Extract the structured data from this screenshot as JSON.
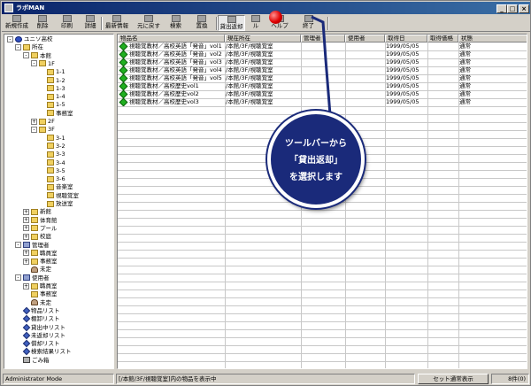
{
  "window": {
    "title": "ラボMAN",
    "controls": [
      "_",
      "□",
      "×"
    ]
  },
  "toolbar": [
    {
      "label": "新規作成",
      "icon": "new-doc-icon"
    },
    {
      "label": "削除",
      "icon": "delete-icon"
    },
    {
      "label": "印刷",
      "icon": "printer-icon"
    },
    {
      "label": "詳細",
      "icon": "detail-icon"
    },
    {
      "label": "最新情報",
      "icon": "refresh-icon"
    },
    {
      "label": "元に戻す",
      "icon": "undo-icon"
    },
    {
      "label": "検索",
      "icon": "search-icon"
    },
    {
      "label": "置換",
      "icon": "replace-icon"
    },
    {
      "label": "貸出返却",
      "icon": "lend-return-icon"
    },
    {
      "label": "ル",
      "icon": "tool-icon"
    },
    {
      "label": "ヘルプ",
      "icon": "help-icon"
    },
    {
      "label": "終了",
      "icon": "exit-icon"
    }
  ],
  "tree": [
    {
      "label": "ユニソ高校",
      "level": 0,
      "icon": "globe",
      "exp": "-"
    },
    {
      "label": "所在",
      "level": 1,
      "icon": "folder",
      "exp": "-"
    },
    {
      "label": "本館",
      "level": 2,
      "icon": "folder",
      "exp": "-"
    },
    {
      "label": "1F",
      "level": 3,
      "icon": "folder",
      "exp": "-"
    },
    {
      "label": "1-1",
      "level": 4,
      "icon": "folder",
      "exp": ""
    },
    {
      "label": "1-2",
      "level": 4,
      "icon": "folder",
      "exp": ""
    },
    {
      "label": "1-3",
      "level": 4,
      "icon": "folder",
      "exp": ""
    },
    {
      "label": "1-4",
      "level": 4,
      "icon": "folder",
      "exp": ""
    },
    {
      "label": "1-5",
      "level": 4,
      "icon": "folder",
      "exp": ""
    },
    {
      "label": "事務室",
      "level": 4,
      "icon": "folder",
      "exp": ""
    },
    {
      "label": "2F",
      "level": 3,
      "icon": "folder",
      "exp": "+"
    },
    {
      "label": "3F",
      "level": 3,
      "icon": "folder",
      "exp": "-"
    },
    {
      "label": "3-1",
      "level": 4,
      "icon": "folder",
      "exp": ""
    },
    {
      "label": "3-2",
      "level": 4,
      "icon": "folder",
      "exp": ""
    },
    {
      "label": "3-3",
      "level": 4,
      "icon": "folder",
      "exp": ""
    },
    {
      "label": "3-4",
      "level": 4,
      "icon": "folder",
      "exp": ""
    },
    {
      "label": "3-5",
      "level": 4,
      "icon": "folder",
      "exp": ""
    },
    {
      "label": "3-6",
      "level": 4,
      "icon": "folder",
      "exp": ""
    },
    {
      "label": "音楽室",
      "level": 4,
      "icon": "folder",
      "exp": ""
    },
    {
      "label": "視聴覚室",
      "level": 4,
      "icon": "folder",
      "exp": ""
    },
    {
      "label": "放送室",
      "level": 4,
      "icon": "folder",
      "exp": ""
    },
    {
      "label": "新館",
      "level": 2,
      "icon": "folder",
      "exp": "+"
    },
    {
      "label": "体育館",
      "level": 2,
      "icon": "folder",
      "exp": "+"
    },
    {
      "label": "プール",
      "level": 2,
      "icon": "folder",
      "exp": "+"
    },
    {
      "label": "校庭",
      "level": 2,
      "icon": "folder",
      "exp": "+"
    },
    {
      "label": "管理者",
      "level": 1,
      "icon": "grp",
      "exp": "-"
    },
    {
      "label": "職員室",
      "level": 2,
      "icon": "folder",
      "exp": "+"
    },
    {
      "label": "事務室",
      "level": 2,
      "icon": "folder",
      "exp": "+"
    },
    {
      "label": "未定",
      "level": 2,
      "icon": "user",
      "exp": ""
    },
    {
      "label": "使用者",
      "level": 1,
      "icon": "grp",
      "exp": "-"
    },
    {
      "label": "職員室",
      "level": 2,
      "icon": "folder",
      "exp": "+"
    },
    {
      "label": "事務室",
      "level": 2,
      "icon": "folder",
      "exp": ""
    },
    {
      "label": "未定",
      "level": 2,
      "icon": "user",
      "exp": ""
    },
    {
      "label": "物品リスト",
      "level": 1,
      "icon": "list",
      "exp": ""
    },
    {
      "label": "棚卸リスト",
      "level": 1,
      "icon": "list",
      "exp": ""
    },
    {
      "label": "貸出中リスト",
      "level": 1,
      "icon": "list",
      "exp": ""
    },
    {
      "label": "未返却リスト",
      "level": 1,
      "icon": "list",
      "exp": ""
    },
    {
      "label": "償却リスト",
      "level": 1,
      "icon": "list",
      "exp": ""
    },
    {
      "label": "検索結果リスト",
      "level": 1,
      "icon": "list",
      "exp": ""
    },
    {
      "label": "ごみ箱",
      "level": 1,
      "icon": "trash",
      "exp": ""
    }
  ],
  "grid": {
    "columns": [
      "物品名",
      "現在所在",
      "管理者",
      "使用者",
      "取得日",
      "取得価格",
      "状態"
    ],
    "rows": [
      [
        "視聴覚教材／高校英語「発音」vol1",
        "/本館/3F/視聴覚室",
        "",
        "",
        "1999/05/05",
        "",
        "通常"
      ],
      [
        "視聴覚教材／高校英語「発音」vol2",
        "/本館/3F/視聴覚室",
        "",
        "",
        "1999/05/05",
        "",
        "通常"
      ],
      [
        "視聴覚教材／高校英語「発音」vol3",
        "/本館/3F/視聴覚室",
        "",
        "",
        "1999/05/05",
        "",
        "通常"
      ],
      [
        "視聴覚教材／高校英語「発音」vol4",
        "/本館/3F/視聴覚室",
        "",
        "",
        "1999/05/05",
        "",
        "通常"
      ],
      [
        "視聴覚教材／高校英語「発音」vol5",
        "/本館/3F/視聴覚室",
        "",
        "",
        "1999/05/05",
        "",
        "通常"
      ],
      [
        "視聴覚教材／高校歴史vol1",
        "/本館/3F/視聴覚室",
        "",
        "",
        "1999/05/05",
        "",
        "通常"
      ],
      [
        "視聴覚教材／高校歴史vol2",
        "/本館/3F/視聴覚室",
        "",
        "",
        "1999/05/05",
        "",
        "通常"
      ],
      [
        "視聴覚教材／高校歴史vol3",
        "/本館/3F/視聴覚室",
        "",
        "",
        "1999/05/05",
        "",
        "通常"
      ]
    ]
  },
  "callout": {
    "line1": "ツールバーから",
    "line2": "「貸出返却」",
    "line3": "を選択します"
  },
  "status": {
    "mode": "Administrator Mode",
    "message": "[/本館/3F/視聴覚室]内の物品を表示中",
    "button": "セット通常表示",
    "count": "8件(0)"
  }
}
